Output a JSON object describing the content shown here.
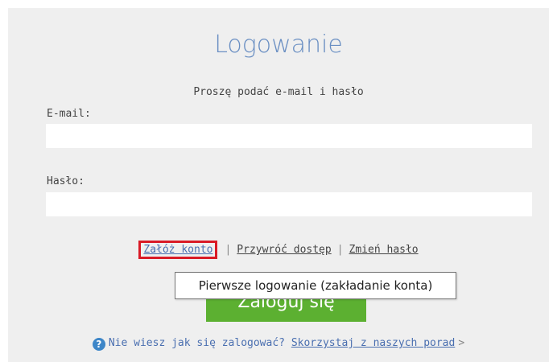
{
  "title": "Logowanie",
  "subtitle": "Proszę podać e-mail i hasło",
  "email": {
    "label": "E-mail:",
    "value": ""
  },
  "password": {
    "label": "Hasło:",
    "value": ""
  },
  "links": {
    "create_account": "Załóż konto",
    "separator": "|",
    "restore_access": "Przywróć dostęp",
    "change_password": "Zmień hasło"
  },
  "login_button": "Zaloguj się",
  "tooltip": "Pierwsze logowanie (zakładanie konta)",
  "help": {
    "icon": "question-circle-icon",
    "text": "Nie wiesz jak się zalogować?",
    "link": "Skorzystaj z naszych porad",
    "arrow": ">"
  },
  "colors": {
    "title": "#6a8fc3",
    "button": "#5cb031",
    "highlight": "#d91a26",
    "link": "#4a6fb0"
  }
}
